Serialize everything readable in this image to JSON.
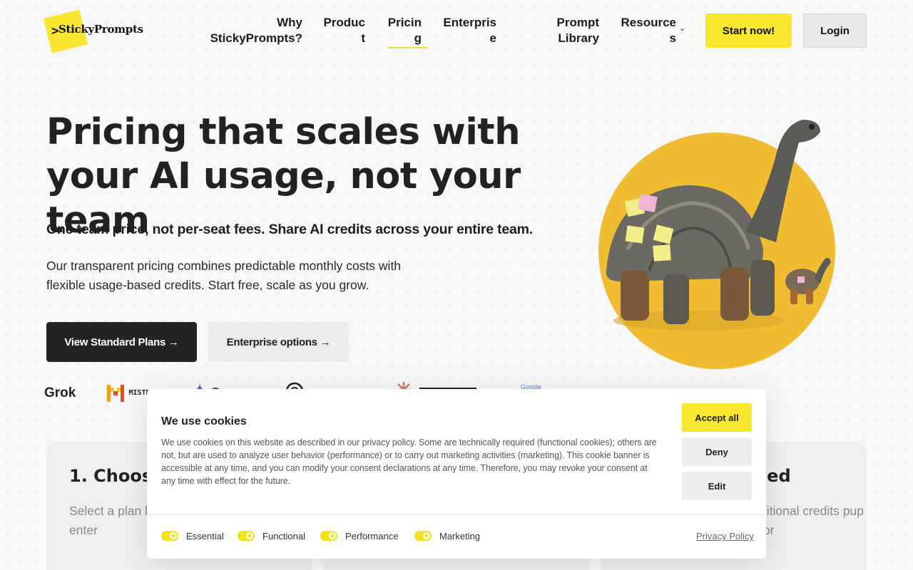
{
  "brand": {
    "name": "StickyPrompts",
    "caret": ">",
    "accent_color": "#f9e72f"
  },
  "nav": {
    "items": [
      "Why StickyPrompts?",
      "Product",
      "Pricing",
      "Enterprise",
      "Prompt Library",
      "Resources"
    ],
    "active": "Pricing",
    "start_label": "Start now!",
    "login_label": "Login"
  },
  "hero": {
    "title": "Pricing that scales with your AI usage, not your team",
    "subtitle": "One team price, not per-seat fees. Share AI credits across your entire team.",
    "body": "Our transparent pricing combines predictable monthly costs with flexible usage-based credits. Start free, scale as you grow.",
    "primary_cta": "View Standard Plans →",
    "secondary_cta": "Enterprise options →"
  },
  "logos": {
    "grok": "Grok",
    "mistral": "MISTRAL AI_",
    "google": "Google"
  },
  "cards": [
    {
      "title": "1. Choose",
      "body": "Select a plan b members nee users to enter"
    },
    {
      "title": "ded",
      "body": "ditional credits pup for"
    }
  ],
  "cookie": {
    "title": "We use cookies",
    "text": "We use cookies on this website as described in our privacy policy. Some are technically required (functional cookies); others are not, but are used to analyze user behavior (performance) or to carry out marketing activities (marketing). This cookie banner is accessible at any time, and you can modify your consent declarations at any time. Therefore, you may revoke your consent at any time with effect for the future.",
    "accept_label": "Accept all",
    "deny_label": "Deny",
    "edit_label": "Edit",
    "toggles": [
      {
        "label": "Essential",
        "on": true
      },
      {
        "label": "Functional",
        "on": true
      },
      {
        "label": "Performance",
        "on": true
      },
      {
        "label": "Marketing",
        "on": true
      }
    ],
    "privacy_label": "Privacy Policy"
  }
}
